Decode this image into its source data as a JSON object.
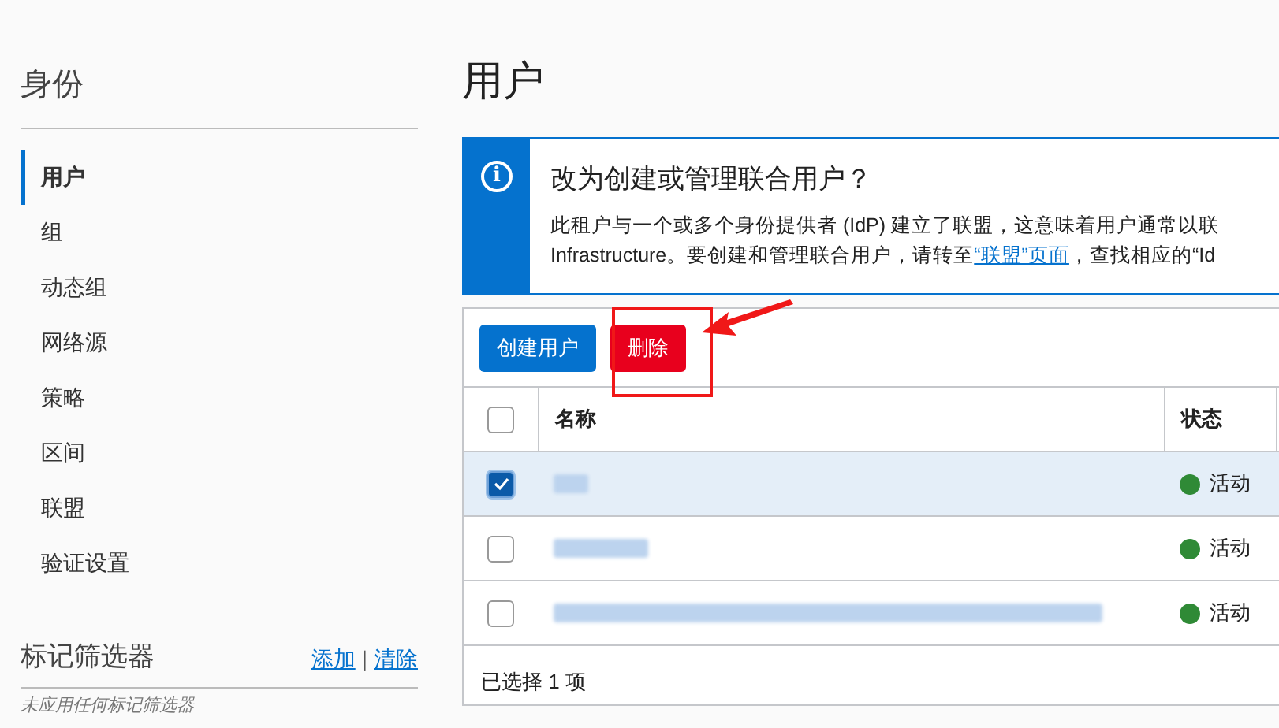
{
  "sidebar": {
    "title": "身份",
    "items": [
      {
        "label": "用户",
        "selected": true
      },
      {
        "label": "组",
        "selected": false
      },
      {
        "label": "动态组",
        "selected": false
      },
      {
        "label": "网络源",
        "selected": false
      },
      {
        "label": "策略",
        "selected": false
      },
      {
        "label": "区间",
        "selected": false
      },
      {
        "label": "联盟",
        "selected": false
      },
      {
        "label": "验证设置",
        "selected": false
      }
    ],
    "tag_filter": {
      "title": "标记筛选器",
      "add": "添加",
      "separator": "|",
      "clear": "清除",
      "empty": "未应用任何标记筛选器"
    }
  },
  "page_title": "用户",
  "banner": {
    "icon": "i",
    "title": "改为创建或管理联合用户？",
    "line1": "此租户与一个或多个身份提供者 (IdP) 建立了联盟，这意味着用户通常以联",
    "line2_before": "Infrastructure。要创建和管理联合用户，请转至",
    "link": "“联盟”页面",
    "line2_after": "，查找相应的“Id"
  },
  "toolbar": {
    "create": "创建用户",
    "delete": "删除"
  },
  "table": {
    "columns": [
      "名称",
      "状态"
    ],
    "header_checked": false,
    "rows": [
      {
        "selected": true,
        "status": "活动"
      },
      {
        "selected": false,
        "status": "活动"
      },
      {
        "selected": false,
        "status": "活动"
      }
    ],
    "footer": "已选择 1 项"
  }
}
